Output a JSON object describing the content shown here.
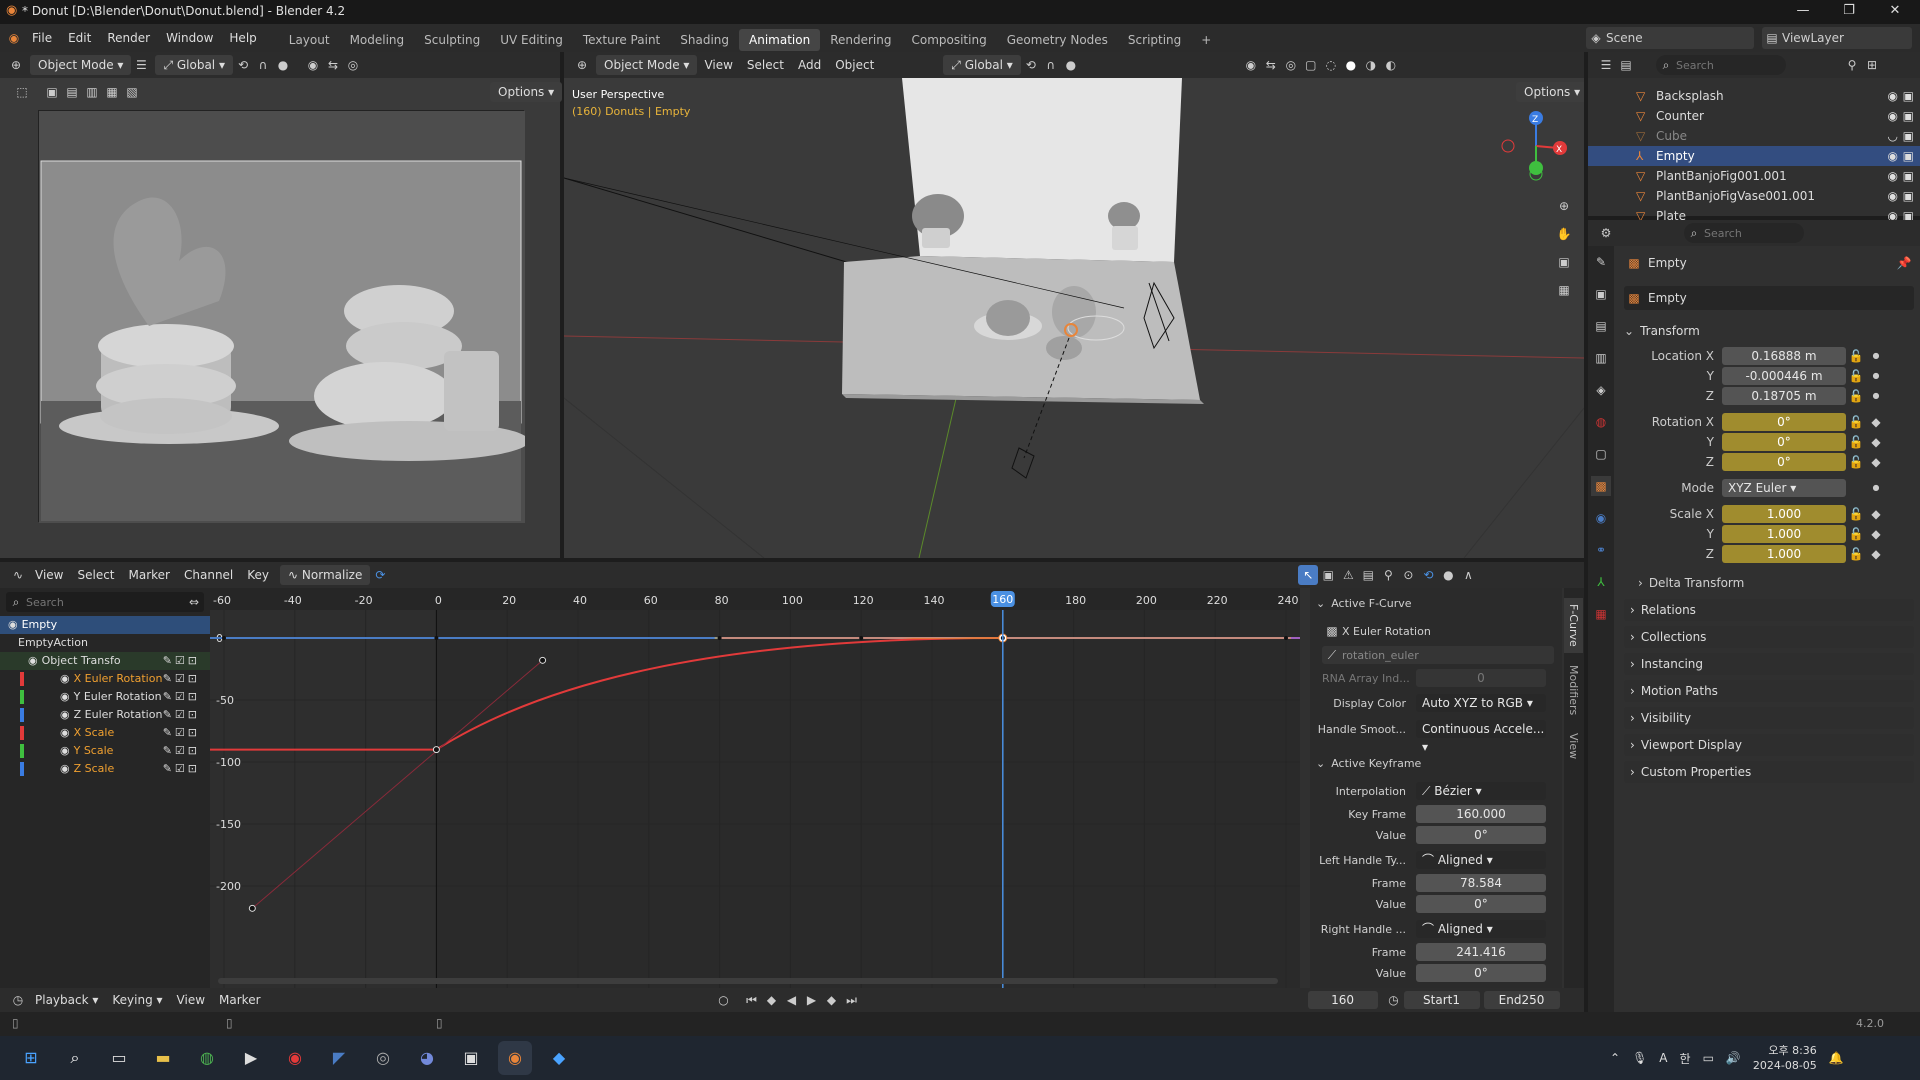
{
  "window": {
    "title": "* Donut [D:\\Blender\\Donut\\Donut.blend] - Blender 4.2"
  },
  "menu": [
    "File",
    "Edit",
    "Render",
    "Window",
    "Help"
  ],
  "workspaces": [
    "Layout",
    "Modeling",
    "Sculpting",
    "UV Editing",
    "Texture Paint",
    "Shading",
    "Animation",
    "Rendering",
    "Compositing",
    "Geometry Nodes",
    "Scripting"
  ],
  "active_workspace": "Animation",
  "scene": "Scene",
  "viewlayer": "ViewLayer",
  "left_vp": {
    "mode": "Object Mode",
    "orient": "Global",
    "options": "Options"
  },
  "main_vp": {
    "mode": "Object Mode",
    "menus": [
      "View",
      "Select",
      "Add",
      "Object"
    ],
    "orient": "Global",
    "options": "Options",
    "persp": "User Perspective",
    "frame_info": "(160) Donuts | Empty"
  },
  "outliner": {
    "search": "Search",
    "items": [
      "Backsplash",
      "Counter",
      "Cube",
      "Empty",
      "PlantBanjoFig001.001",
      "PlantBanjoFigVase001.001",
      "Plate"
    ],
    "selected": 3
  },
  "props": {
    "search": "Search",
    "object": "Empty",
    "datablock": "Empty",
    "transform": "Transform",
    "loc": {
      "label": "Location X",
      "x": "0.16888 m",
      "y": "-0.000446 m",
      "z": "0.18705 m"
    },
    "rot": {
      "label": "Rotation X",
      "x": "0°",
      "y": "0°",
      "z": "0°"
    },
    "mode_label": "Mode",
    "mode": "XYZ Euler",
    "scale": {
      "label": "Scale X",
      "x": "1.000",
      "y": "1.000",
      "z": "1.000"
    },
    "axis_y": "Y",
    "axis_z": "Z",
    "delta": "Delta Transform",
    "sections": [
      "Relations",
      "Collections",
      "Instancing",
      "Motion Paths",
      "Visibility",
      "Viewport Display",
      "Custom Properties"
    ]
  },
  "graph": {
    "menus": [
      "View",
      "Select",
      "Marker",
      "Channel",
      "Key"
    ],
    "normalize": "Normalize",
    "search": "Search",
    "channels": [
      {
        "name": "Empty",
        "color": "#4a7cc4",
        "level": 0
      },
      {
        "name": "EmptyAction",
        "color": "",
        "level": 1
      },
      {
        "name": "Object Transfo",
        "color": "#3fa040",
        "level": 2
      },
      {
        "name": "X Euler Rotation",
        "color": "#e23a3a",
        "level": 3
      },
      {
        "name": "Y Euler Rotation",
        "color": "#3fbf3f",
        "level": 3
      },
      {
        "name": "Z Euler Rotation",
        "color": "#3a7ce2",
        "level": 3
      },
      {
        "name": "X Scale",
        "color": "#e23a3a",
        "level": 3
      },
      {
        "name": "Y Scale",
        "color": "#3fbf3f",
        "level": 3
      },
      {
        "name": "Z Scale",
        "color": "#3a7ce2",
        "level": 3
      }
    ],
    "frame_ticks": [
      "-60",
      "-40",
      "-20",
      "0",
      "20",
      "40",
      "60",
      "80",
      "100",
      "120",
      "140",
      "160",
      "180",
      "200",
      "220",
      "240"
    ],
    "value_ticks": [
      "0",
      "-50",
      "-100",
      "-150",
      "-200"
    ],
    "current_frame": "160"
  },
  "sidebar": {
    "tabs": [
      "F-Curve",
      "Modifiers",
      "View"
    ],
    "active_fcurve": "Active F-Curve",
    "channel": "X Euler Rotation",
    "path": "rotation_euler",
    "rna_label": "RNA Array Ind...",
    "rna": "0",
    "display_color_label": "Display Color",
    "display_color": "Auto XYZ to RGB",
    "handle_smooth_label": "Handle Smoot...",
    "handle_smooth": "Continuous Accele...",
    "active_kf": "Active Keyframe",
    "interp_label": "Interpolation",
    "interp": "Bézier",
    "keyframe_label": "Key Frame",
    "keyframe": "160.000",
    "value_label": "Value",
    "value": "0°",
    "lh_label": "Left Handle Ty...",
    "lh": "Aligned",
    "lh_frame_label": "Frame",
    "lh_frame": "78.584",
    "lh_value": "0°",
    "rh_label": "Right Handle ...",
    "rh": "Aligned",
    "rh_frame": "241.416",
    "rh_value": "0°"
  },
  "timeline": {
    "menus": [
      "Playback",
      "Keying",
      "View",
      "Marker"
    ],
    "frame": "160",
    "start_label": "Start",
    "start": "1",
    "end_label": "End",
    "end": "250"
  },
  "status": {
    "version": "4.2.0"
  },
  "taskbar": {
    "time": "오후 8:36",
    "date": "2024-08-05",
    "lang": "A",
    "ime": "한"
  }
}
